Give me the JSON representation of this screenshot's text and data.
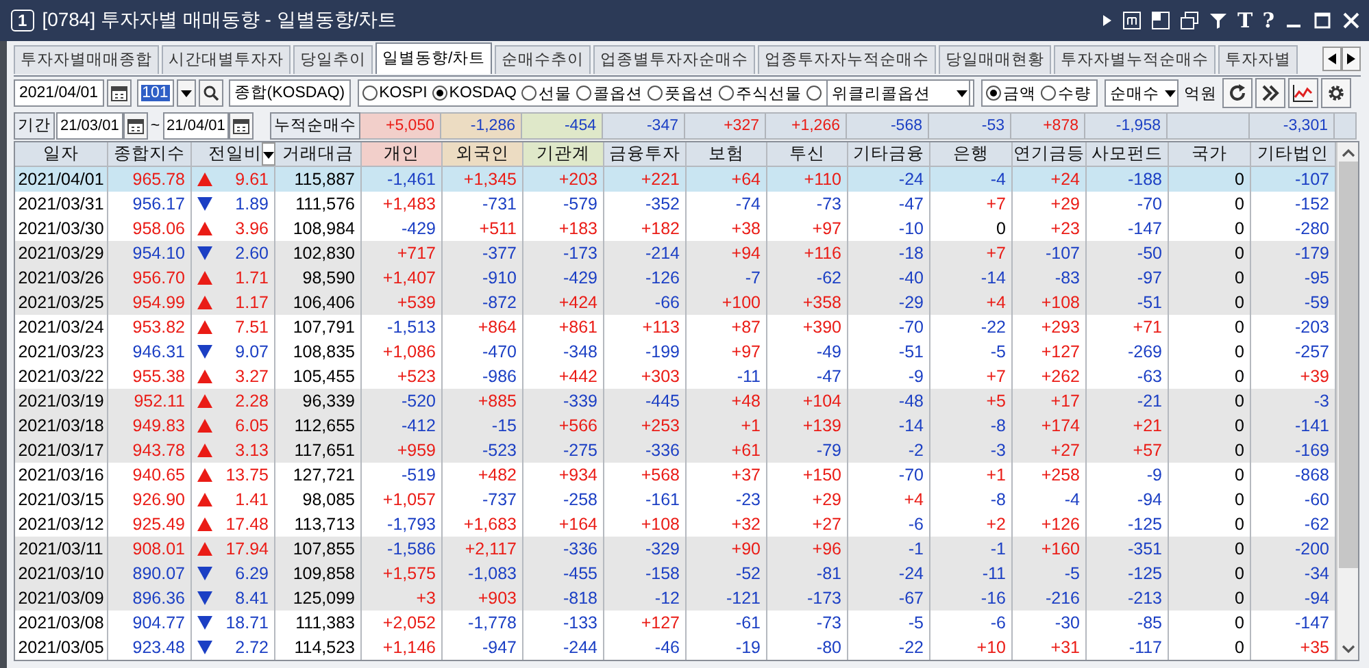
{
  "window": {
    "number": "1",
    "title": "[0784] 투자자별 매매동향 - 일별동향/차트",
    "text_buttons": [
      "T",
      "?"
    ]
  },
  "tabs": [
    {
      "label": "투자자별매매종합",
      "selected": false
    },
    {
      "label": "시간대별투자자",
      "selected": false
    },
    {
      "label": "당일추이",
      "selected": false
    },
    {
      "label": "일별동향/차트",
      "selected": true
    },
    {
      "label": "순매수추이",
      "selected": false
    },
    {
      "label": "업종별투자자순매수",
      "selected": false
    },
    {
      "label": "업종투자자누적순매수",
      "selected": false
    },
    {
      "label": "당일매매현황",
      "selected": false
    },
    {
      "label": "투자자별누적순매수",
      "selected": false
    },
    {
      "label": "투자자별",
      "selected": false
    }
  ],
  "toolbar": {
    "date": "2021/04/01",
    "code": "101",
    "name": "종합(KOSDAQ)",
    "markets": [
      {
        "kind": "radio",
        "label": "KOSPI",
        "selected": false
      },
      {
        "kind": "radio",
        "label": "KOSDAQ",
        "selected": true
      },
      {
        "kind": "radio",
        "label": "선물",
        "selected": false
      },
      {
        "kind": "radio",
        "label": "콜옵션",
        "selected": false
      },
      {
        "kind": "radio",
        "label": "풋옵션",
        "selected": false
      },
      {
        "kind": "radio",
        "label": "주식선물",
        "selected": false
      },
      {
        "kind": "radio-dropdown",
        "label": "위클리콜옵션",
        "selected": false
      }
    ],
    "units": [
      {
        "label": "금액",
        "selected": true
      },
      {
        "label": "수량",
        "selected": false
      }
    ],
    "mode": "순매수",
    "unit_label": "억원"
  },
  "summary": {
    "period_label": "기간",
    "from": "21/03/01",
    "separator": "~",
    "to": "21/04/01",
    "label": "누적순매수",
    "cells": [
      {
        "blank": false,
        "value": "+5,050"
      },
      {
        "blank": false,
        "value": "-1,286"
      },
      {
        "blank": false,
        "value": "-454"
      },
      {
        "blank": false,
        "value": "-347"
      },
      {
        "blank": false,
        "value": "+327"
      },
      {
        "blank": false,
        "value": "+1,266"
      },
      {
        "blank": false,
        "value": "-568"
      },
      {
        "blank": false,
        "value": "-53"
      },
      {
        "blank": false,
        "value": "+878"
      },
      {
        "blank": false,
        "value": "-1,958"
      },
      {
        "blank": true
      },
      {
        "blank": false,
        "value": "-3,301"
      }
    ]
  },
  "table": {
    "columns": [
      {
        "label": "일자",
        "kind": "text",
        "color": "#d9e1ea"
      },
      {
        "label": "종합지수",
        "kind": "text",
        "color": "#d9e1ea"
      },
      {
        "label": "전일비",
        "kind": "menu",
        "color": "#d9e1ea"
      },
      {
        "label": "거래대금",
        "kind": "text",
        "color": "#d9e1ea"
      },
      {
        "label": "개인",
        "kind": "text",
        "color": "#f2cfca"
      },
      {
        "label": "외국인",
        "kind": "text",
        "color": "#ecdcc2"
      },
      {
        "label": "기관계",
        "kind": "text",
        "color": "#dfe8c9"
      },
      {
        "label": "금융투자",
        "kind": "text",
        "color": "#d9e1ea"
      },
      {
        "label": "보험",
        "kind": "text",
        "color": "#d9e1ea"
      },
      {
        "label": "투신",
        "kind": "text",
        "color": "#d9e1ea"
      },
      {
        "label": "기타금융",
        "kind": "text",
        "color": "#d9e1ea"
      },
      {
        "label": "은행",
        "kind": "text",
        "color": "#d9e1ea"
      },
      {
        "label": "연기금등",
        "kind": "text",
        "color": "#d9e1ea"
      },
      {
        "label": "사모펀드",
        "kind": "text",
        "color": "#d9e1ea"
      },
      {
        "label": "국가",
        "kind": "text",
        "color": "#d9e1ea"
      },
      {
        "label": "기타법인",
        "kind": "text",
        "color": "#d9e1ea"
      }
    ],
    "rows": [
      {
        "selected": true,
        "date": "2021/04/01",
        "index": "965.78",
        "rising": true,
        "change": "9.61",
        "amount": "115,887",
        "values": [
          "-1,461",
          "+1,345",
          "+203",
          "+221",
          "+64",
          "+110",
          "-24",
          "-4",
          "+24",
          "-188",
          "0",
          "-107"
        ]
      },
      {
        "selected": false,
        "date": "2021/03/31",
        "index": "956.17",
        "rising": false,
        "change": "1.89",
        "amount": "111,576",
        "values": [
          "+1,483",
          "-731",
          "-579",
          "-352",
          "-74",
          "-73",
          "-47",
          "+7",
          "+29",
          "-70",
          "0",
          "-152"
        ]
      },
      {
        "selected": false,
        "date": "2021/03/30",
        "index": "958.06",
        "rising": true,
        "change": "3.96",
        "amount": "108,984",
        "values": [
          "-429",
          "+511",
          "+183",
          "+182",
          "+38",
          "+97",
          "-10",
          "0",
          "+23",
          "-147",
          "0",
          "-280"
        ]
      },
      {
        "selected": false,
        "date": "2021/03/29",
        "index": "954.10",
        "rising": false,
        "change": "2.60",
        "amount": "102,830",
        "values": [
          "+717",
          "-377",
          "-173",
          "-214",
          "+94",
          "+116",
          "-18",
          "+7",
          "-107",
          "-50",
          "0",
          "-179"
        ]
      },
      {
        "selected": false,
        "date": "2021/03/26",
        "index": "956.70",
        "rising": true,
        "change": "1.71",
        "amount": "98,590",
        "values": [
          "+1,407",
          "-910",
          "-429",
          "-126",
          "-7",
          "-62",
          "-40",
          "-14",
          "-83",
          "-97",
          "0",
          "-95"
        ]
      },
      {
        "selected": false,
        "date": "2021/03/25",
        "index": "954.99",
        "rising": true,
        "change": "1.17",
        "amount": "106,406",
        "values": [
          "+539",
          "-872",
          "+424",
          "-66",
          "+100",
          "+358",
          "-29",
          "+4",
          "+108",
          "-51",
          "0",
          "-59"
        ]
      },
      {
        "selected": false,
        "date": "2021/03/24",
        "index": "953.82",
        "rising": true,
        "change": "7.51",
        "amount": "107,791",
        "values": [
          "-1,513",
          "+864",
          "+861",
          "+113",
          "+87",
          "+390",
          "-70",
          "-22",
          "+293",
          "+71",
          "0",
          "-203"
        ]
      },
      {
        "selected": false,
        "date": "2021/03/23",
        "index": "946.31",
        "rising": false,
        "change": "9.07",
        "amount": "108,835",
        "values": [
          "+1,086",
          "-470",
          "-348",
          "-199",
          "+97",
          "-49",
          "-51",
          "-5",
          "+127",
          "-269",
          "0",
          "-257"
        ]
      },
      {
        "selected": false,
        "date": "2021/03/22",
        "index": "955.38",
        "rising": true,
        "change": "3.27",
        "amount": "105,455",
        "values": [
          "+523",
          "-986",
          "+442",
          "+303",
          "-11",
          "-47",
          "-9",
          "+7",
          "+262",
          "-63",
          "0",
          "+39"
        ]
      },
      {
        "selected": false,
        "date": "2021/03/19",
        "index": "952.11",
        "rising": true,
        "change": "2.28",
        "amount": "96,339",
        "values": [
          "-520",
          "+885",
          "-339",
          "-445",
          "+48",
          "+104",
          "-48",
          "+5",
          "+17",
          "-21",
          "0",
          "-3"
        ]
      },
      {
        "selected": false,
        "date": "2021/03/18",
        "index": "949.83",
        "rising": true,
        "change": "6.05",
        "amount": "112,655",
        "values": [
          "-412",
          "-15",
          "+566",
          "+253",
          "+1",
          "+139",
          "-14",
          "-8",
          "+174",
          "+21",
          "0",
          "-141"
        ]
      },
      {
        "selected": false,
        "date": "2021/03/17",
        "index": "943.78",
        "rising": true,
        "change": "3.13",
        "amount": "117,651",
        "values": [
          "+959",
          "-523",
          "-275",
          "-336",
          "+61",
          "-79",
          "-2",
          "-3",
          "+27",
          "+57",
          "0",
          "-169"
        ]
      },
      {
        "selected": false,
        "date": "2021/03/16",
        "index": "940.65",
        "rising": true,
        "change": "13.75",
        "amount": "127,721",
        "values": [
          "-519",
          "+482",
          "+934",
          "+568",
          "+37",
          "+150",
          "-70",
          "+1",
          "+258",
          "-9",
          "0",
          "-868"
        ]
      },
      {
        "selected": false,
        "date": "2021/03/15",
        "index": "926.90",
        "rising": true,
        "change": "1.41",
        "amount": "98,085",
        "values": [
          "+1,057",
          "-737",
          "-258",
          "-161",
          "-23",
          "+29",
          "+4",
          "-8",
          "-4",
          "-94",
          "0",
          "-60"
        ]
      },
      {
        "selected": false,
        "date": "2021/03/12",
        "index": "925.49",
        "rising": true,
        "change": "17.48",
        "amount": "113,713",
        "values": [
          "-1,793",
          "+1,683",
          "+164",
          "+108",
          "+32",
          "+27",
          "-6",
          "+2",
          "+126",
          "-125",
          "0",
          "-62"
        ]
      },
      {
        "selected": false,
        "date": "2021/03/11",
        "index": "908.01",
        "rising": true,
        "change": "17.94",
        "amount": "107,855",
        "values": [
          "-1,586",
          "+2,117",
          "-336",
          "-329",
          "+90",
          "+96",
          "-1",
          "-1",
          "+160",
          "-351",
          "0",
          "-200"
        ]
      },
      {
        "selected": false,
        "date": "2021/03/10",
        "index": "890.07",
        "rising": false,
        "change": "6.29",
        "amount": "109,858",
        "values": [
          "+1,575",
          "-1,083",
          "-455",
          "-158",
          "-52",
          "-81",
          "-24",
          "-11",
          "-5",
          "-125",
          "0",
          "-34"
        ]
      },
      {
        "selected": false,
        "date": "2021/03/09",
        "index": "896.36",
        "rising": false,
        "change": "8.41",
        "amount": "125,099",
        "values": [
          "+3",
          "+903",
          "-818",
          "-12",
          "-121",
          "-173",
          "-67",
          "-16",
          "-216",
          "-213",
          "0",
          "-94"
        ]
      },
      {
        "selected": false,
        "date": "2021/03/08",
        "index": "904.77",
        "rising": false,
        "change": "18.71",
        "amount": "111,383",
        "values": [
          "+2,052",
          "-1,778",
          "-133",
          "+127",
          "-61",
          "-73",
          "-5",
          "-6",
          "-30",
          "-85",
          "0",
          "-147"
        ]
      },
      {
        "selected": false,
        "date": "2021/03/05",
        "index": "923.48",
        "rising": false,
        "change": "2.72",
        "amount": "114,523",
        "values": [
          "+1,146",
          "-947",
          "-244",
          "-46",
          "-19",
          "-80",
          "-22",
          "+10",
          "+31",
          "-117",
          "0",
          "+35"
        ]
      }
    ]
  }
}
